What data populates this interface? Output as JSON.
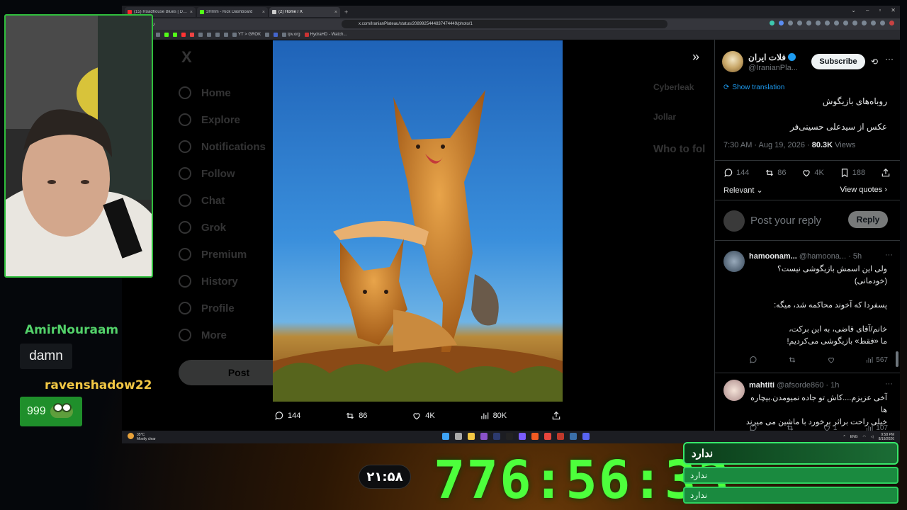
{
  "browser": {
    "tabs": [
      {
        "title": "(15) Roadhouse Blues | Delta Slide G",
        "color": "#ff2a2a",
        "active": false
      },
      {
        "title": "3Hmm - Kick Dashboard",
        "color": "#53fc18",
        "active": false
      },
      {
        "title": "(2) Home / X",
        "color": "#cccccc",
        "active": true
      }
    ],
    "url": "x.com/IranianPlateau/status/2089925444837474449/photo/1",
    "bookmarks": [
      "YT > GROK",
      "ipv.org",
      "HydraHD - Watch..."
    ]
  },
  "x_background": {
    "logo": "X",
    "nav": [
      "Home",
      "Explore",
      "Notifications",
      "Follow",
      "Chat",
      "Grok",
      "Premium",
      "History",
      "Profile",
      "More"
    ],
    "post_label": "Post",
    "right_items": [
      "Cyberleak",
      "Jollar"
    ],
    "who_to_follow": "Who to fol"
  },
  "photo_actions": {
    "replies": "144",
    "reposts": "86",
    "likes": "4K",
    "views": "80K"
  },
  "tweet": {
    "display_name": "فلات ایران",
    "handle": "@IranianPla...",
    "subscribe": "Subscribe",
    "show_translation": "Show translation",
    "text_line1": "روباه‌های بازیگوش",
    "text_line2": "عکس از سیدعلی حسینی‌فر",
    "time": "7:30 AM · Aug 19, 2026 · ",
    "views_count": "80.3K",
    "views_label": " Views",
    "stats": {
      "replies": "144",
      "reposts": "86",
      "likes": "4K",
      "bookmarks": "188"
    },
    "sort": "Relevant",
    "view_quotes": "View quotes",
    "reply_placeholder": "Post your reply",
    "reply_button": "Reply"
  },
  "comments": [
    {
      "name": "hamoonam...",
      "handle": "@hamoona... · 5h",
      "lines": [
        "ولی این اسمش بازیگوشی نیست؟",
        "(خودمانی)",
        "",
        "پسفردا که آخوند محاکمه شد، میگه:",
        "",
        "خانم/آقای قاضی، به این برکت،",
        "ما «فقط» بازیگوشی می‌کردیم!"
      ],
      "likes_count": "567"
    },
    {
      "name": "mahtiti",
      "handle": "@afsorde860 · 1h",
      "lines": [
        "آخی عزیزم....کاش تو جاده نمیومدن.بیچاره ها",
        "خیلی راحت براثر برخورد با ماشین می میرند"
      ],
      "likes_count": "1",
      "views_count": "107"
    }
  ],
  "taskbar": {
    "temp": "35°C",
    "weather": "Mostly clear",
    "time": "9:58 PM",
    "date": "8/19/2026",
    "lang": "ENG"
  },
  "stream": {
    "chat": [
      {
        "user": "AmirNouraam",
        "message": "damn",
        "color": "#53d26a"
      },
      {
        "user": "ravenshadow22",
        "message": "999",
        "color": "#f2c744"
      }
    ],
    "mini_timer": "۲۱:۵۸",
    "big_timer": "776:56:33",
    "goal_title": "ندارد",
    "goal_rows": [
      "ندارد",
      "ندارد"
    ]
  }
}
